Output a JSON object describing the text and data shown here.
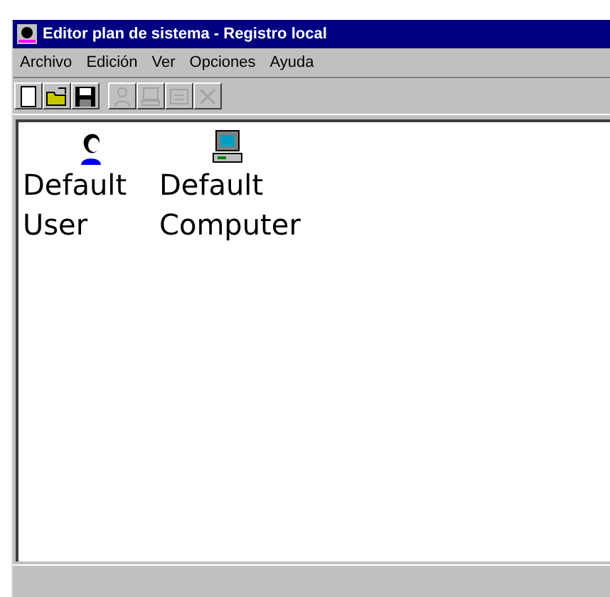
{
  "window": {
    "title": "Editor plan de sistema - Registro local"
  },
  "menu": [
    "Archivo",
    "Edición",
    "Ver",
    "Opciones",
    "Ayuda"
  ],
  "toolbar": [
    {
      "kind": "new",
      "disabled": false
    },
    {
      "kind": "open",
      "disabled": false
    },
    {
      "kind": "save",
      "disabled": false
    },
    {
      "kind": "add-user",
      "disabled": true
    },
    {
      "kind": "add-computer",
      "disabled": true
    },
    {
      "kind": "add-group",
      "disabled": true
    },
    {
      "kind": "remove",
      "disabled": true
    }
  ],
  "items": [
    {
      "kind": "user",
      "label": "Default User"
    },
    {
      "kind": "computer",
      "label": "Default Computer"
    }
  ]
}
